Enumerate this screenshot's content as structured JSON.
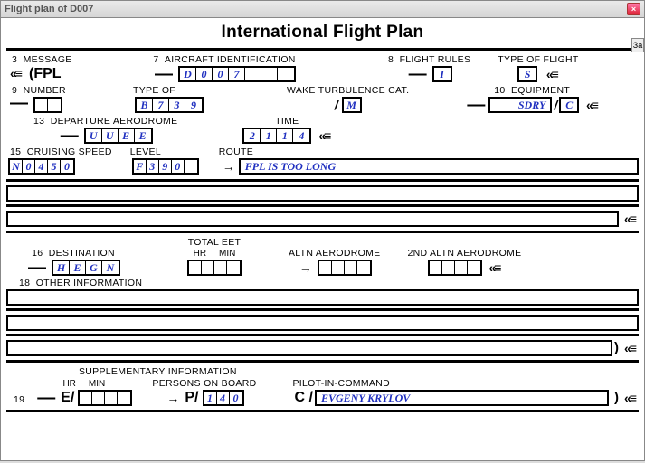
{
  "window": {
    "title": "Flight plan of D007",
    "side_label": "За"
  },
  "heading": "International Flight Plan",
  "item3": {
    "no": "3",
    "label": "MESSAGE",
    "fpl": "(FPL"
  },
  "item7": {
    "no": "7",
    "label": "AIRCRAFT IDENTIFICATION",
    "value": "D007"
  },
  "item8": {
    "no": "8",
    "label": "FLIGHT RULES",
    "value": "I"
  },
  "typeflight": {
    "label": "TYPE OF FLIGHT",
    "value": "S"
  },
  "item9": {
    "no": "9",
    "label": "NUMBER",
    "value": ""
  },
  "typeof": {
    "label": "TYPE OF",
    "value": "B739"
  },
  "wake": {
    "label": "WAKE TURBULENCE CAT.",
    "value": "M"
  },
  "item10": {
    "no": "10",
    "label": "EQUIPMENT",
    "value": "SDRY",
    "surv": "C"
  },
  "item13": {
    "no": "13",
    "label": "DEPARTURE AERODROME",
    "value": "UUEE",
    "time_label": "TIME",
    "time": "2114"
  },
  "item15": {
    "no": "15",
    "label": "CRUISING SPEED",
    "value": "N0450",
    "level_label": "LEVEL",
    "level": "F390",
    "route_label": "ROUTE",
    "route": "FPL IS TOO LONG"
  },
  "totaleet": {
    "label": "TOTAL EET",
    "hr": "HR",
    "min": "MIN"
  },
  "item16": {
    "no": "16",
    "label": "DESTINATION",
    "value": "HEGN",
    "altn_label": "ALTN AERODROME",
    "altn2_label": "2ND ALTN AERODROME"
  },
  "item18": {
    "no": "18",
    "label": "OTHER INFORMATION"
  },
  "item19": {
    "no": "19",
    "label": "SUPPLEMENTARY INFORMATION",
    "hr": "HR",
    "min": "MIN",
    "pob_label": "PERSONS ON BOARD",
    "pob": "140",
    "pic_label": "PILOT-IN-COMMAND",
    "pic": "EVGENY KRYLOV"
  }
}
